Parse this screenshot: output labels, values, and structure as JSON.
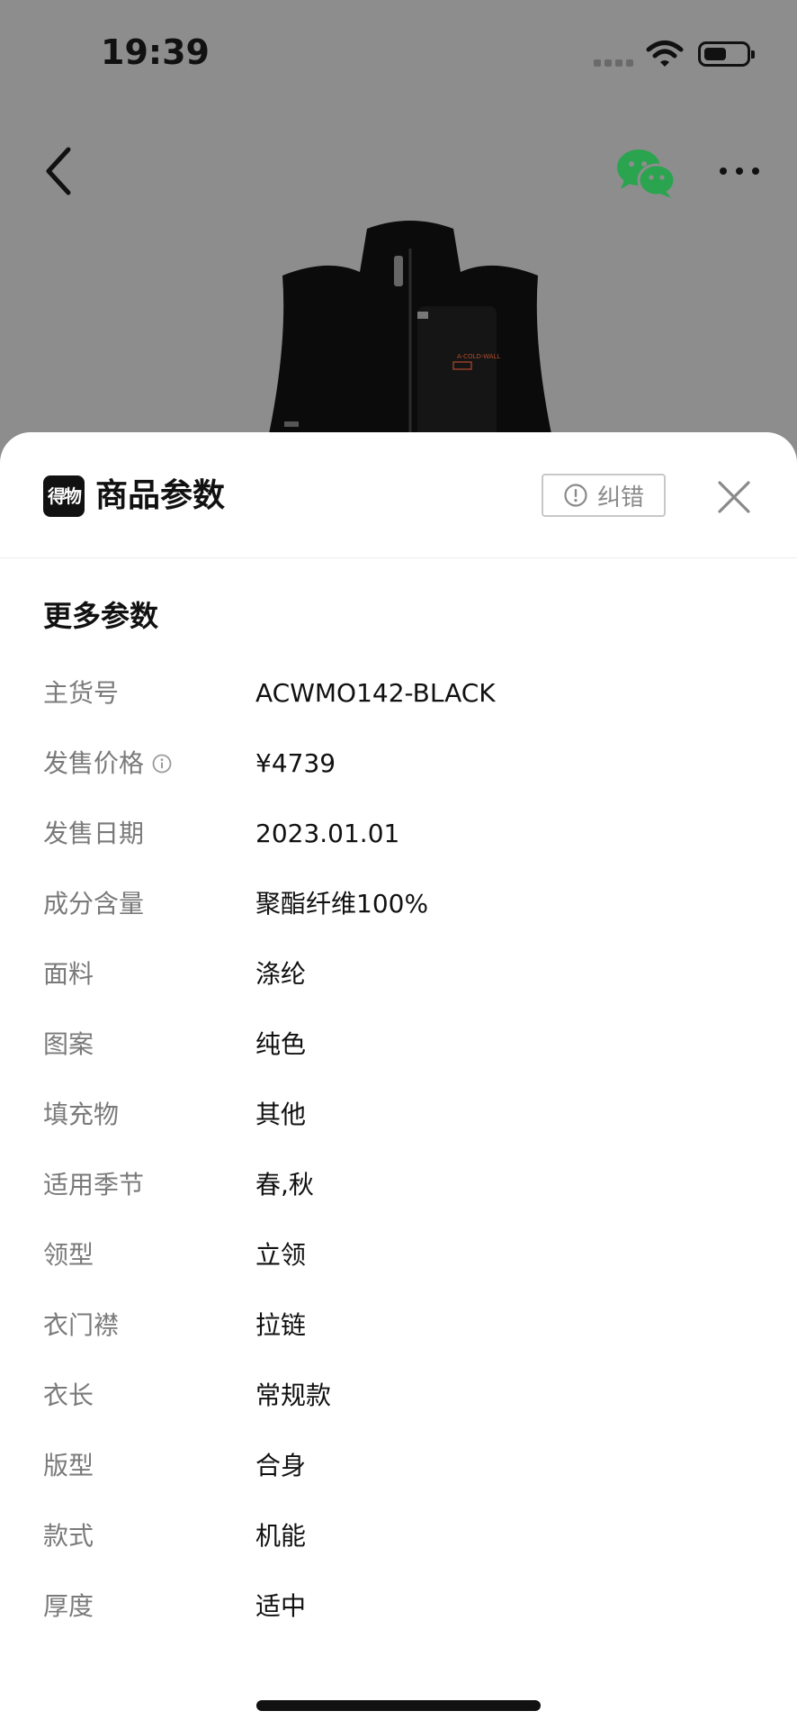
{
  "status_bar": {
    "time": "19:39"
  },
  "sheet": {
    "logo_text": "得物",
    "title": "商品参数",
    "correct_button_label": "纠错",
    "section_title": "更多参数",
    "params": [
      {
        "label": "主货号",
        "value": "ACWMO142-BLACK",
        "info": false
      },
      {
        "label": "发售价格",
        "value": "¥4739",
        "info": true
      },
      {
        "label": "发售日期",
        "value": "2023.01.01",
        "info": false
      },
      {
        "label": "成分含量",
        "value": "聚酯纤维100%",
        "info": false
      },
      {
        "label": "面料",
        "value": "涤纶",
        "info": false
      },
      {
        "label": "图案",
        "value": "纯色",
        "info": false
      },
      {
        "label": "填充物",
        "value": "其他",
        "info": false
      },
      {
        "label": "适用季节",
        "value": "春,秋",
        "info": false
      },
      {
        "label": "领型",
        "value": "立领",
        "info": false
      },
      {
        "label": "衣门襟",
        "value": "拉链",
        "info": false
      },
      {
        "label": "衣长",
        "value": "常规款",
        "info": false
      },
      {
        "label": "版型",
        "value": "合身",
        "info": false
      },
      {
        "label": "款式",
        "value": "机能",
        "info": false
      },
      {
        "label": "厚度",
        "value": "适中",
        "info": false
      }
    ]
  },
  "icons": {
    "back": "chevron-left-icon",
    "share": "wechat-icon",
    "more": "more-dots-icon",
    "correct": "alert-circle-icon",
    "close": "close-icon",
    "info": "info-icon"
  },
  "colors": {
    "overlay": "#8d8d8d",
    "sheet_bg": "#ffffff",
    "wechat_green": "#2aa44f",
    "label_gray": "#7a7a7a"
  }
}
